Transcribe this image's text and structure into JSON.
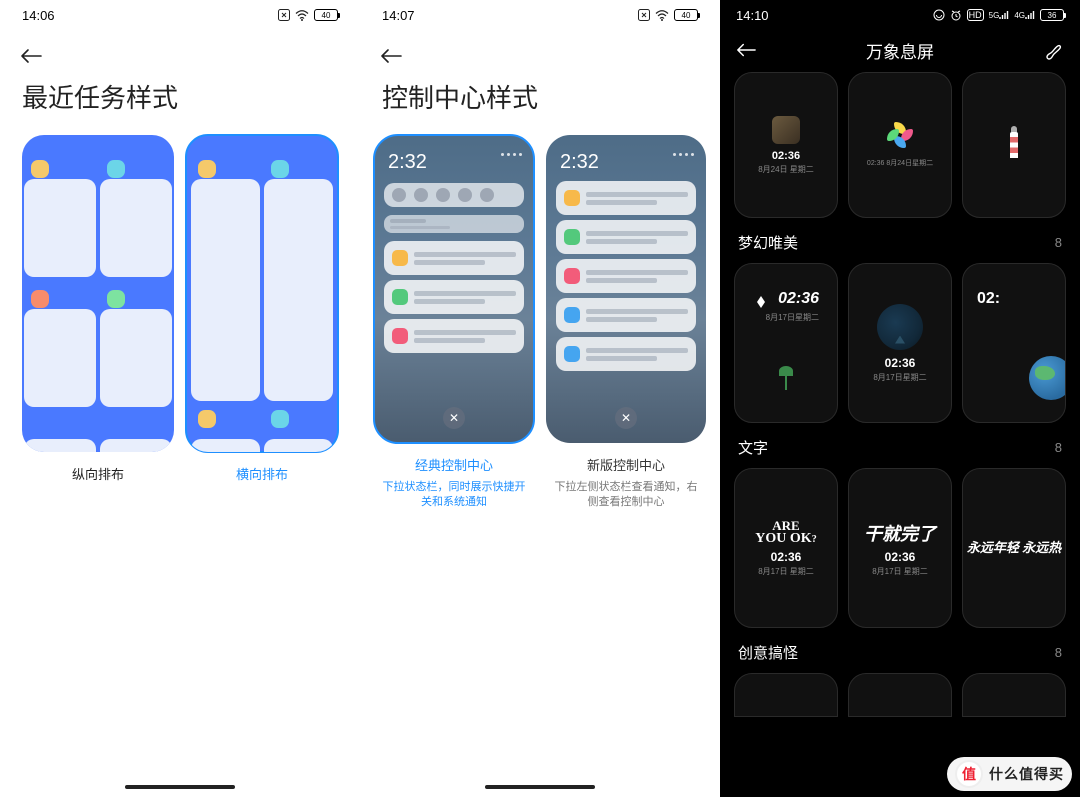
{
  "panel1": {
    "time": "14:06",
    "battery": "40",
    "title": "最近任务样式",
    "options": [
      {
        "label": "纵向排布",
        "selected": false
      },
      {
        "label": "横向排布",
        "selected": true
      }
    ]
  },
  "panel2": {
    "time": "14:07",
    "battery": "40",
    "title": "控制中心样式",
    "preview_time": "2:32",
    "options": [
      {
        "label": "经典控制中心",
        "desc": "下拉状态栏，同时展示快捷开关和系统通知",
        "selected": true
      },
      {
        "label": "新版控制中心",
        "desc": "下拉左侧状态栏查看通知，右侧查看控制中心",
        "selected": false
      }
    ]
  },
  "panel3": {
    "time": "14:10",
    "battery": "36",
    "title": "万象息屏",
    "top_row": [
      {
        "time": "02:36",
        "sub": ""
      },
      {
        "time": "",
        "sub": ""
      },
      {
        "time": "",
        "sub": ""
      }
    ],
    "sections": [
      {
        "name": "梦幻唯美",
        "count": "8",
        "items": [
          {
            "main": "02:36",
            "sub": "8月17日星期二"
          },
          {
            "main": "02:36",
            "sub": "8月17日星期二"
          },
          {
            "main": "02:",
            "sub": ""
          }
        ]
      },
      {
        "name": "文字",
        "count": "8",
        "items": [
          {
            "main": "ARE YOU OK?",
            "sub": "02:36",
            "sub2": "8月17日 星期二"
          },
          {
            "main": "干就完了",
            "sub": "02:36",
            "sub2": "8月17日 星期二"
          },
          {
            "main": "永远年轻 永远热",
            "sub": "",
            "sub2": ""
          }
        ]
      },
      {
        "name": "创意搞怪",
        "count": "8",
        "items": []
      }
    ]
  },
  "watermark": "什么值得买"
}
